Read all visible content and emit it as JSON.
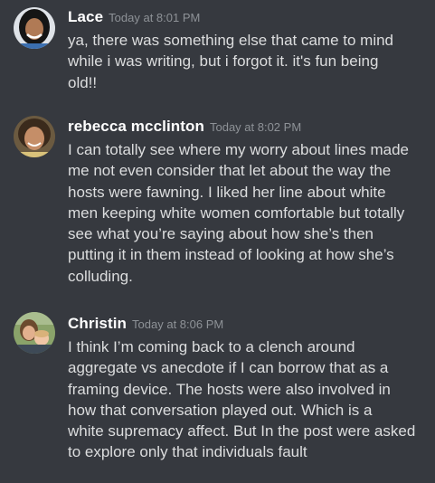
{
  "messages": [
    {
      "username": "Lace",
      "timestamp": "Today at 8:01 PM",
      "avatar_icon": "user-avatar-lace",
      "lines": [
        "ya, there was something else that came to mind",
        "while i was writing, but i forgot it. it's fun being",
        "old!!"
      ]
    },
    {
      "username": "rebecca mcclinton",
      "timestamp": "Today at 8:02 PM",
      "avatar_icon": "user-avatar-rebecca",
      "lines": [
        "I can totally see where my worry about lines made",
        "me not even consider that let about the way the",
        "hosts were fawning. I liked her line about white",
        "men keeping white women comfortable but totally",
        "see what you’re saying about how she’s then",
        "putting it in them instead of looking at how she’s",
        "colluding."
      ]
    },
    {
      "username": "Christin",
      "timestamp": "Today at 8:06 PM",
      "avatar_icon": "user-avatar-christin",
      "lines": [
        "I think I’m coming back to a clench around",
        "aggregate vs anecdote if I can borrow that as a",
        "framing device. The hosts were also involved in",
        "how that conversation played out. Which is a",
        "white supremacy affect. But In the post were asked",
        "to explore only that individuals fault"
      ]
    }
  ],
  "colors": {
    "background": "#36393f",
    "username": "#ffffff",
    "timestamp": "#8e9297",
    "message_text": "#dcddde"
  }
}
